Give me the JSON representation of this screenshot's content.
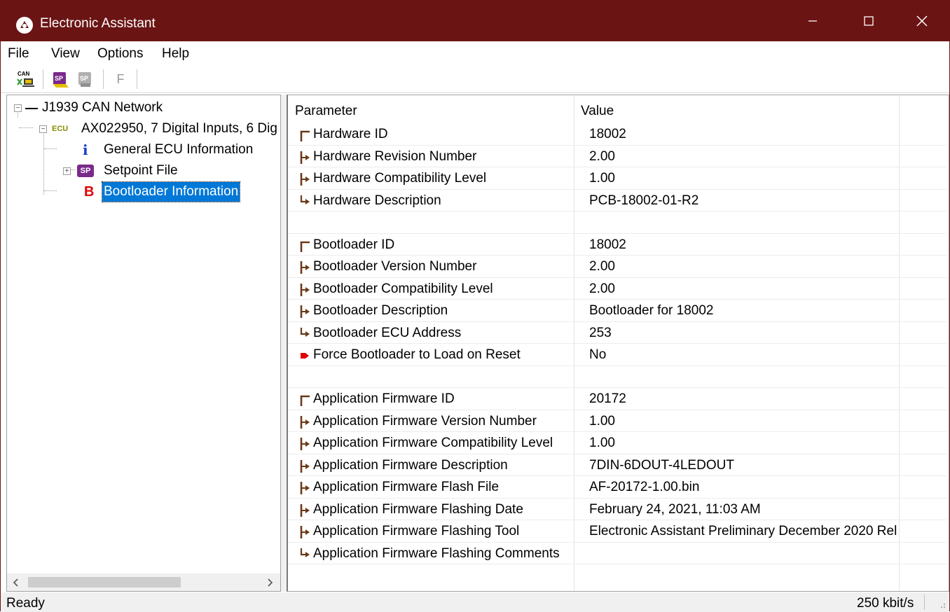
{
  "window": {
    "title": "Electronic Assistant"
  },
  "menu": [
    "File",
    "View",
    "Options",
    "Help"
  ],
  "toolbar": {
    "can_label": "CAN",
    "f_label": "F"
  },
  "tree": {
    "network": "J1939 CAN Network",
    "ecu_tag": "ECU",
    "ecu": "AX022950, 7 Digital Inputs, 6 Dig",
    "general": "General ECU Information",
    "setpoint": "Setpoint File",
    "bootloader": "Bootloader Information",
    "info_glyph": "i",
    "sp_glyph": "SP",
    "b_glyph": "B"
  },
  "table": {
    "headers": {
      "parameter": "Parameter",
      "value": "Value"
    },
    "rows": [
      {
        "param": "Hardware ID",
        "value": "18002",
        "marker": "first"
      },
      {
        "param": "Hardware Revision Number",
        "value": "2.00",
        "marker": "mid"
      },
      {
        "param": "Hardware Compatibility Level",
        "value": "1.00",
        "marker": "mid"
      },
      {
        "param": "Hardware Description",
        "value": "PCB-18002-01-R2",
        "marker": "last"
      },
      {
        "param": "",
        "value": "",
        "marker": "none"
      },
      {
        "param": "Bootloader ID",
        "value": "18002",
        "marker": "first"
      },
      {
        "param": "Bootloader Version Number",
        "value": "2.00",
        "marker": "mid"
      },
      {
        "param": "Bootloader Compatibility Level",
        "value": "2.00",
        "marker": "mid"
      },
      {
        "param": "Bootloader Description",
        "value": "Bootloader for 18002",
        "marker": "mid"
      },
      {
        "param": "Bootloader ECU Address",
        "value": "253",
        "marker": "last"
      },
      {
        "param": "Force Bootloader to Load on Reset",
        "value": "No",
        "marker": "red"
      },
      {
        "param": "",
        "value": "",
        "marker": "none"
      },
      {
        "param": "Application Firmware ID",
        "value": "20172",
        "marker": "first"
      },
      {
        "param": "Application Firmware Version Number",
        "value": "1.00",
        "marker": "mid"
      },
      {
        "param": "Application Firmware Compatibility Level",
        "value": "1.00",
        "marker": "mid"
      },
      {
        "param": "Application Firmware Description",
        "value": "7DIN-6DOUT-4LEDOUT",
        "marker": "mid"
      },
      {
        "param": "Application Firmware Flash File",
        "value": "AF-20172-1.00.bin",
        "marker": "mid"
      },
      {
        "param": "Application Firmware Flashing Date",
        "value": "February 24, 2021, 11:03 AM",
        "marker": "mid"
      },
      {
        "param": "Application Firmware Flashing Tool",
        "value": "Electronic Assistant Preliminary December 2020 Rel",
        "marker": "mid"
      },
      {
        "param": "Application Firmware Flashing Comments",
        "value": "",
        "marker": "last"
      }
    ]
  },
  "status": {
    "text": "Ready",
    "rate": "250 kbit/s"
  },
  "colors": {
    "title_bar": "#6b1414",
    "selection": "#0078d7",
    "marker": "#6b3a1a",
    "marker_red": "#e00000"
  }
}
